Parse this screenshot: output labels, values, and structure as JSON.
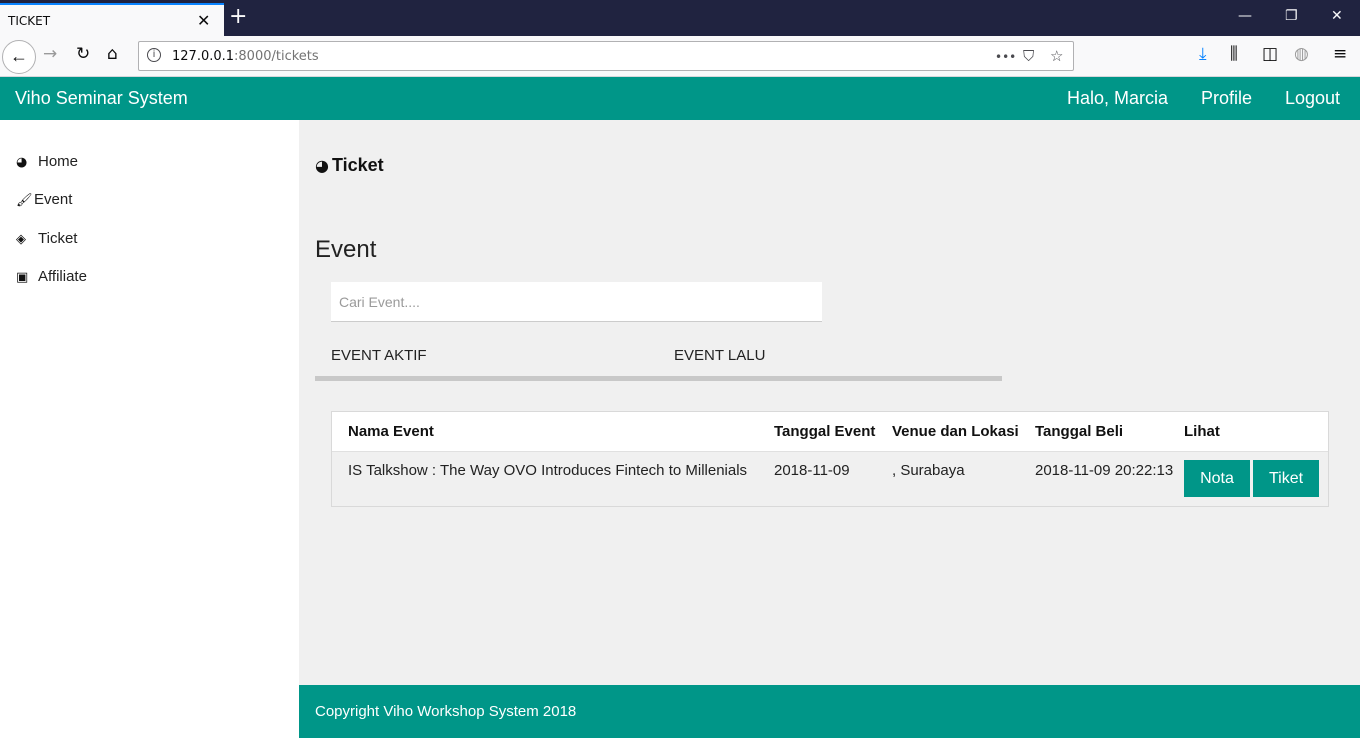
{
  "browser": {
    "tab_title": "TICKET",
    "tab_close": "✕",
    "new_tab": "+",
    "url_host": "127.0.0.1",
    "url_rest": ":8000/tickets",
    "icons": {
      "back": "←",
      "forward": "→",
      "reload": "↻",
      "home": "⌂",
      "more": "•••",
      "pocket": "⛉",
      "star": "☆",
      "download": "⤓",
      "library": "⫼",
      "sidebar": "◫",
      "globe": "◍",
      "menu": "≡",
      "minimize": "—",
      "restore": "❐",
      "close": "✕"
    }
  },
  "header": {
    "brand": "Viho Seminar System",
    "greeting": "Halo, Marcia",
    "profile": "Profile",
    "logout": "Logout"
  },
  "sidebar": {
    "items": [
      {
        "label": "Home",
        "icon": "dashboard-icon",
        "glyph": "◕"
      },
      {
        "label": "Event",
        "icon": "paintbrush-icon",
        "glyph": "🖌"
      },
      {
        "label": "Ticket",
        "icon": "ticket-icon",
        "glyph": "◈"
      },
      {
        "label": "Affiliate",
        "icon": "money-icon",
        "glyph": "▣"
      }
    ]
  },
  "main": {
    "page_title": "Ticket",
    "page_title_glyph": "◕",
    "section_title": "Event",
    "search_placeholder": "Cari Event....",
    "tabs": [
      {
        "label": "EVENT AKTIF",
        "active": true
      },
      {
        "label": "EVENT LALU",
        "active": false
      }
    ],
    "table": {
      "headers": [
        "Nama Event",
        "Tanggal Event",
        "Venue dan Lokasi",
        "Tanggal Beli",
        "Lihat"
      ],
      "rows": [
        {
          "name": "IS Talkshow : The Way OVO Introduces Fintech to Millenials",
          "date": "2018-11-09",
          "venue": ", Surabaya",
          "bought": "2018-11-09 20:22:13",
          "btn_nota": "Nota",
          "btn_tiket": "Tiket"
        }
      ]
    }
  },
  "footer": {
    "text": "Copyright Viho Workshop System 2018"
  },
  "colors": {
    "accent": "#009688",
    "background": "#f0f0f0",
    "browser_dark": "#202340"
  }
}
